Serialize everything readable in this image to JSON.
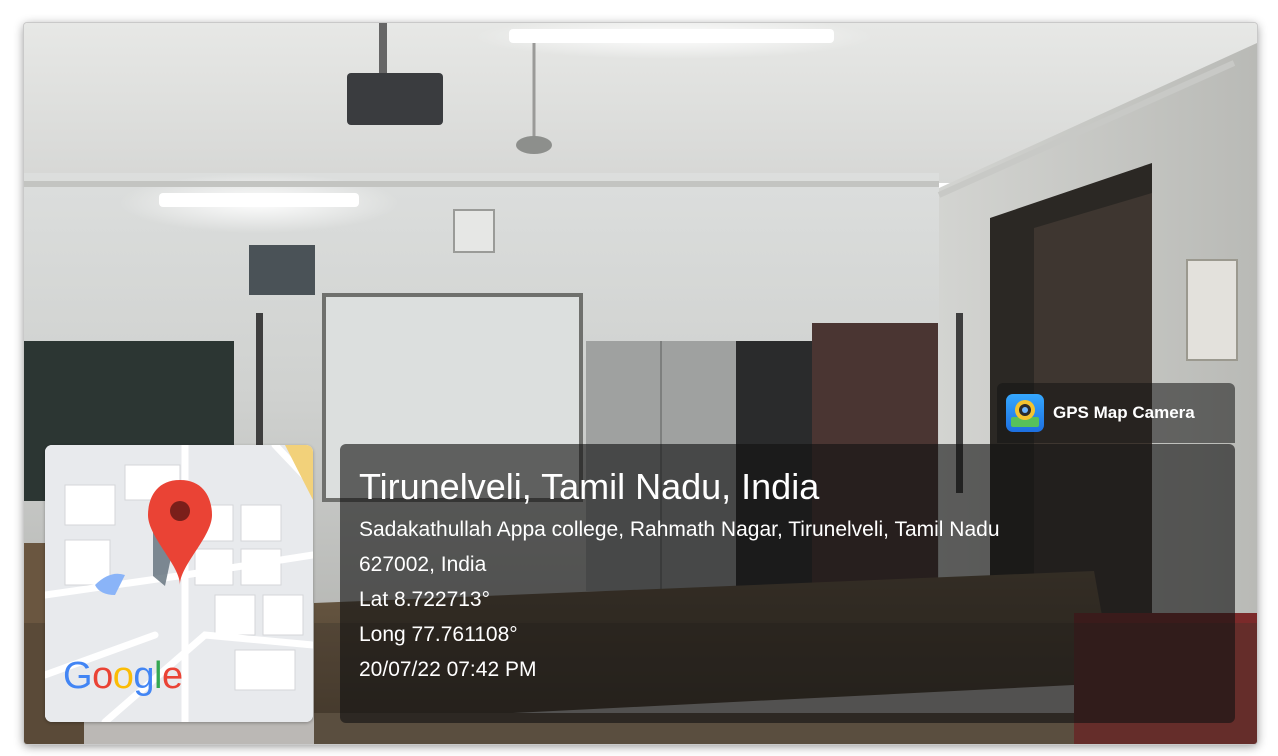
{
  "badge": {
    "app_name": "GPS Map Camera",
    "icon": "gps-map-camera-icon"
  },
  "location": {
    "title": "Tirunelveli, Tamil Nadu, India",
    "address_line1": "Sadakathullah Appa college, Rahmath Nagar, Tirunelveli, Tamil Nadu",
    "address_line2": "627002, India",
    "lat": "Lat 8.722713°",
    "long": "Long 77.761108°",
    "datetime": "20/07/22 07:42 PM"
  },
  "map": {
    "logo_text": [
      "G",
      "o",
      "o",
      "g",
      "l",
      "e"
    ],
    "pin_icon": "map-pin-icon"
  },
  "colors": {
    "pin": "#EA4335",
    "panel": "#121212",
    "map_bg": "#e8eaed"
  }
}
